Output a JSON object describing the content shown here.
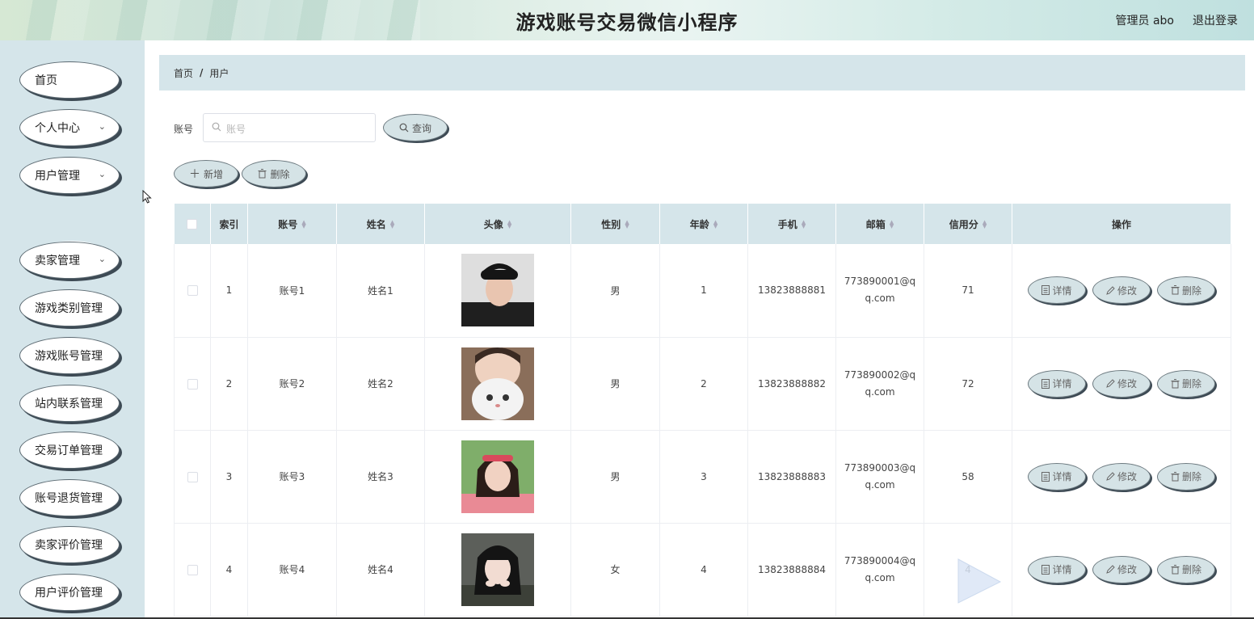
{
  "header": {
    "title": "游戏账号交易微信小程序",
    "user": "管理员 abo",
    "logout": "退出登录"
  },
  "sidebar": {
    "items": [
      {
        "label": "首页",
        "has_arrow": false
      },
      {
        "label": "个人中心",
        "has_arrow": true
      },
      {
        "label": "用户管理",
        "has_arrow": true
      },
      {
        "label": "卖家管理",
        "has_arrow": true
      },
      {
        "label": "游戏类别管理",
        "has_arrow": false
      },
      {
        "label": "游戏账号管理",
        "has_arrow": false
      },
      {
        "label": "站内联系管理",
        "has_arrow": false
      },
      {
        "label": "交易订单管理",
        "has_arrow": false
      },
      {
        "label": "账号退货管理",
        "has_arrow": false
      },
      {
        "label": "卖家评价管理",
        "has_arrow": false
      },
      {
        "label": "用户评价管理",
        "has_arrow": false
      }
    ],
    "sub_item": "用户"
  },
  "breadcrumb": {
    "home": "首页",
    "separator": "/",
    "current": "用户"
  },
  "search": {
    "label": "账号",
    "placeholder": "账号",
    "button": "查询"
  },
  "actions": {
    "add": "新增",
    "delete": "删除"
  },
  "table": {
    "headers": {
      "index": "索引",
      "account": "账号",
      "name": "姓名",
      "avatar": "头像",
      "gender": "性别",
      "age": "年龄",
      "phone": "手机",
      "email": "邮箱",
      "credit": "信用分",
      "ops": "操作"
    },
    "op_labels": {
      "detail": "详情",
      "edit": "修改",
      "delete": "删除"
    },
    "rows": [
      {
        "index": "1",
        "account": "账号1",
        "name": "姓名1",
        "gender": "男",
        "age": "1",
        "phone": "13823888881",
        "email": "773890001@qq.com",
        "credit": "71"
      },
      {
        "index": "2",
        "account": "账号2",
        "name": "姓名2",
        "gender": "男",
        "age": "2",
        "phone": "13823888882",
        "email": "773890002@qq.com",
        "credit": "72"
      },
      {
        "index": "3",
        "account": "账号3",
        "name": "姓名3",
        "gender": "男",
        "age": "3",
        "phone": "13823888883",
        "email": "773890003@qq.com",
        "credit": "58"
      },
      {
        "index": "4",
        "account": "账号4",
        "name": "姓名4",
        "gender": "女",
        "age": "4",
        "phone": "13823888884",
        "email": "773890004@qq.com",
        "credit": "4"
      }
    ]
  },
  "colors": {
    "sidebar_bg": "#d5e5ea",
    "button_bg": "#d5e3e6",
    "header_bg": "#d6e8d4"
  }
}
